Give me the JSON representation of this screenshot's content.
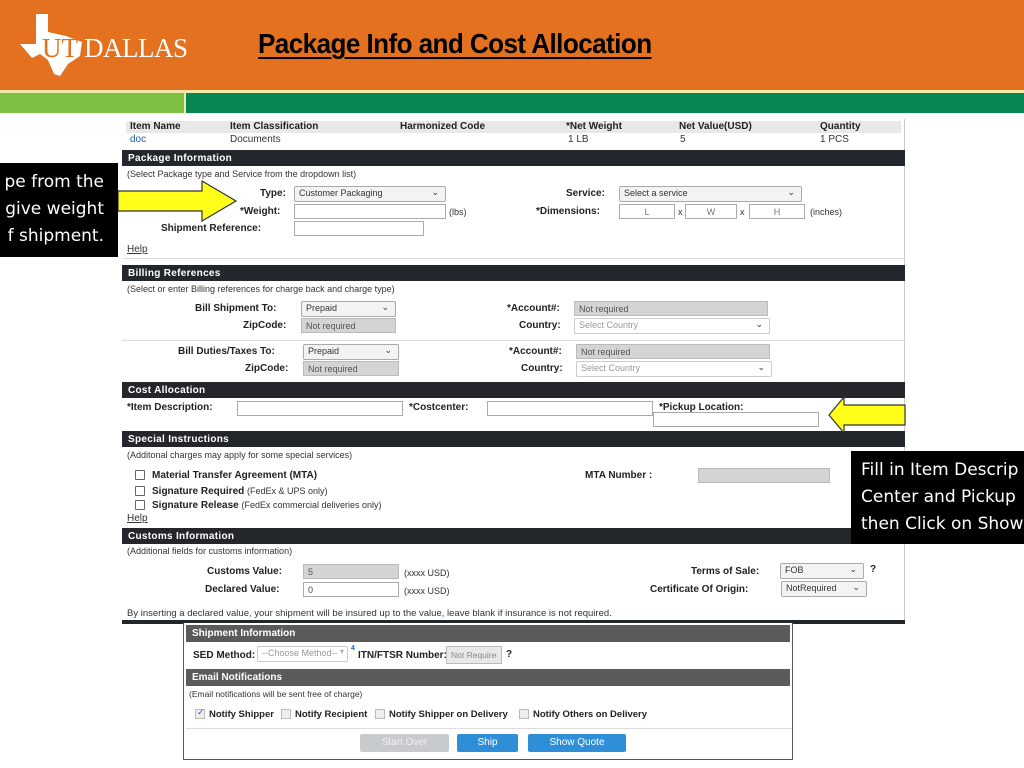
{
  "header": {
    "logo_ut": "UT",
    "logo_text": "DALLAS",
    "title": "Package Info and Cost Allocation",
    "colors": {
      "orange": "#e3711f",
      "light_green": "#7cc142",
      "dark_green": "#068651"
    }
  },
  "callouts": {
    "left": [
      "pe from the",
      "give weight",
      "f shipment."
    ],
    "right": [
      "Fill in Item Descrip",
      "Center and Pickup",
      "then Click on Show"
    ]
  },
  "items_table": {
    "headers": [
      "Item Name",
      "Item Classification",
      "Harmonized Code",
      "*Net Weight",
      "Net Value(USD)",
      "Quantity"
    ],
    "row": [
      "doc",
      "Documents",
      "",
      "1  LB",
      "5",
      "1 PCS"
    ]
  },
  "package_info": {
    "title": "Package Information",
    "note": "(Select Package type and Service from the dropdown list)",
    "type_label": "Type:",
    "type_value": "Customer Packaging",
    "weight_label": "*Weight:",
    "weight_value": "",
    "weight_unit": "(lbs)",
    "shipment_ref_label": "Shipment Reference:",
    "shipment_ref_value": "",
    "service_label": "Service:",
    "service_value": "Select a service",
    "dimensions_label": "*Dimensions:",
    "dim_l": "L",
    "dim_w": "W",
    "dim_h": "H",
    "dim_x": "x",
    "dim_unit": "(inches)",
    "help": "Help"
  },
  "billing": {
    "title": "Billing References",
    "note": "(Select or enter Billing references for charge back and charge type)",
    "bill_shipment_label": "Bill Shipment To:",
    "bill_shipment_value": "Prepaid",
    "zip_label": "ZipCode:",
    "zip_value": "Not required",
    "account_label": "*Account#:",
    "account_value": "Not required",
    "country_label": "Country:",
    "country_value": "Select Country",
    "bill_duties_label": "Bill Duties/Taxes To:",
    "bill_duties_value": "Prepaid",
    "zip2_value": "Not required",
    "account2_value": "Not required",
    "country2_value": "Select Country"
  },
  "cost_allocation": {
    "title": "Cost Allocation",
    "item_desc_label": "*Item Description:",
    "item_desc_value": "",
    "costcenter_label": "*Costcenter:",
    "costcenter_value": "",
    "pickup_label": "*Pickup Location:",
    "pickup_value": ""
  },
  "special_instructions": {
    "title": "Special Instructions",
    "note": "(Additonal charges may apply for some special services)",
    "mta_label": "Material Transfer Agreement (MTA)",
    "mta_number_label": "MTA Number :",
    "mta_number_value": "",
    "sig_required_label": "Signature Required",
    "sig_required_sub": "(FedEx & UPS only)",
    "sig_release_label": "Signature Release",
    "sig_release_sub": "(FedEx commercial deliveries only)",
    "help": "Help"
  },
  "customs": {
    "title": "Customs Information",
    "note": "(Additional fields for customs information)",
    "customs_value_label": "Customs Value:",
    "customs_value": "5",
    "declared_value_label": "Declared Value:",
    "declared_value": "0",
    "usd_hint": "(xxxx USD)",
    "terms_label": "Terms of Sale:",
    "terms_value": "FOB",
    "terms_help": "?",
    "coo_label": "Certificate Of Origin:",
    "coo_value": "NotRequired",
    "footer": "By inserting a declared value, your shipment will be insured up to the value, leave blank if insurance is not required."
  },
  "shipment_info": {
    "title": "Shipment Information",
    "sed_label": "SED Method:",
    "sed_value": "--Choose Method--",
    "sup": "4",
    "itn_label": "ITN/FTSR Number:",
    "itn_value": "Not Required",
    "itn_help": "?"
  },
  "email": {
    "title": "Email Notifications",
    "note": "(Email notifications will be sent free of charge)",
    "options": [
      {
        "label": "Notify Shipper",
        "checked": true
      },
      {
        "label": "Notify Recipient",
        "checked": false
      },
      {
        "label": "Notify Shipper on Delivery",
        "checked": false
      },
      {
        "label": "Notify Others on Delivery",
        "checked": false
      }
    ]
  },
  "buttons": {
    "start_over": "Start Over",
    "ship": "Ship",
    "show_quote": "Show Quote"
  }
}
